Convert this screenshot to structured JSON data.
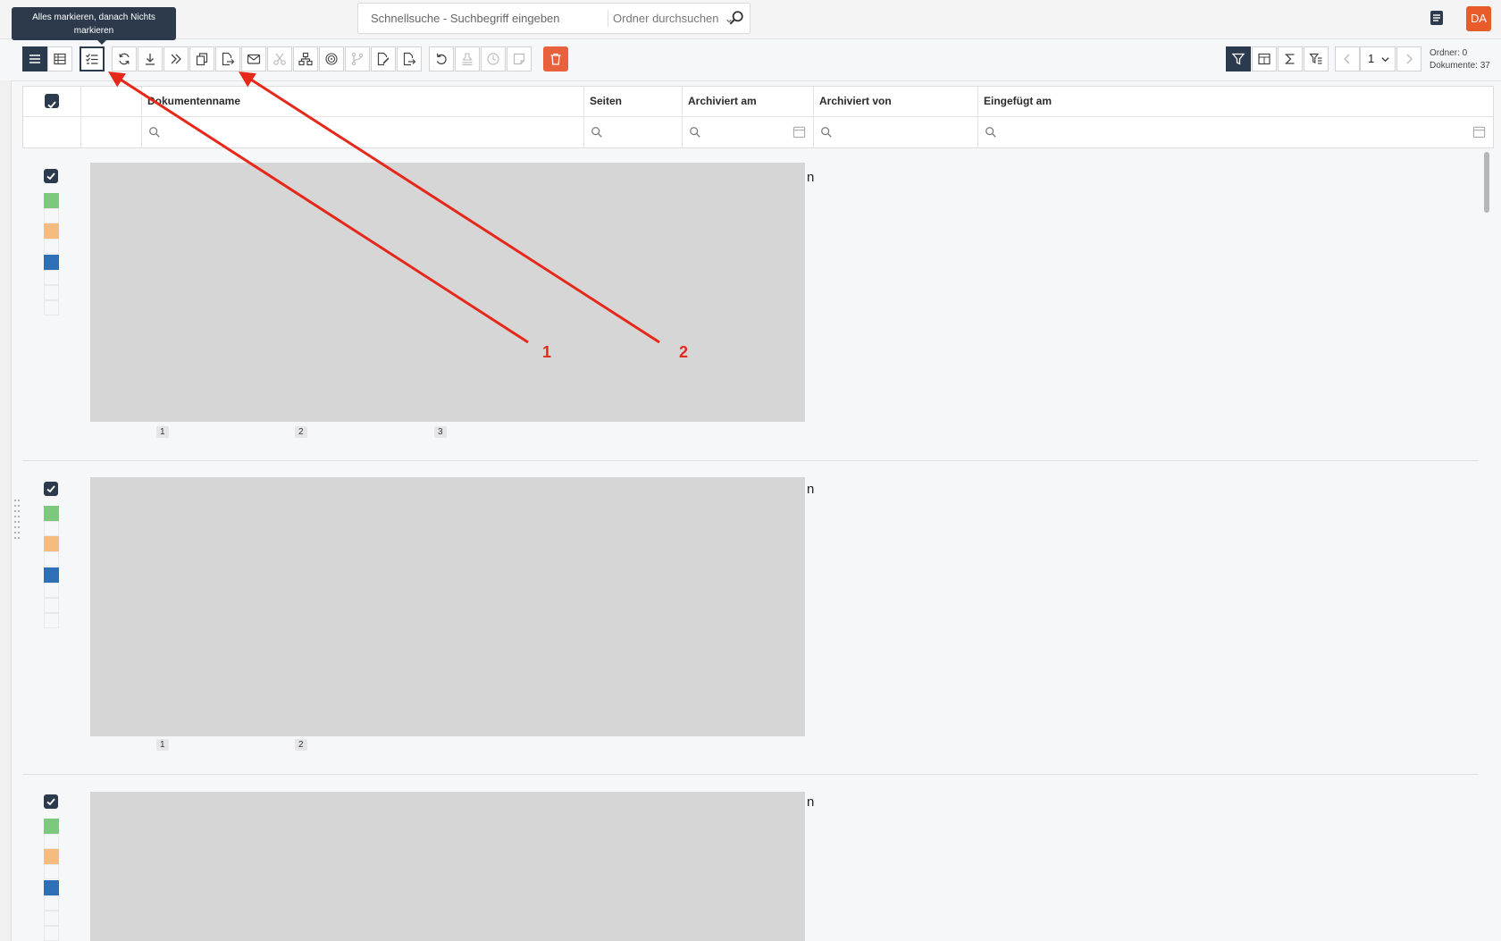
{
  "search": {
    "placeholder": "Schnellsuche - Suchbegriff eingeben",
    "scope_label": "Ordner durchsuchen"
  },
  "user": {
    "initials": "DA"
  },
  "tooltip": {
    "text": "Alles markieren, danach Nichts markieren"
  },
  "toolbar": {
    "page_value": "1",
    "folders_label": "Ordner: 0",
    "documents_label": "Dokumente: 37"
  },
  "grid": {
    "columns": [
      "Dokumentenname",
      "Seiten",
      "Archiviert am",
      "Archiviert von",
      "Eingefügt am"
    ]
  },
  "rows": [
    {
      "pages": [
        "1",
        "2",
        "3"
      ],
      "trailing_text": "n"
    },
    {
      "pages": [
        "1",
        "2"
      ],
      "trailing_text": "n"
    },
    {
      "pages": [],
      "trailing_text": "n"
    }
  ],
  "tag_colors": [
    "#7cc97d",
    "#f6bc7f",
    "#2f6fb6"
  ],
  "annotations": {
    "label_1": "1",
    "label_2": "2",
    "color": "#e6281a"
  }
}
